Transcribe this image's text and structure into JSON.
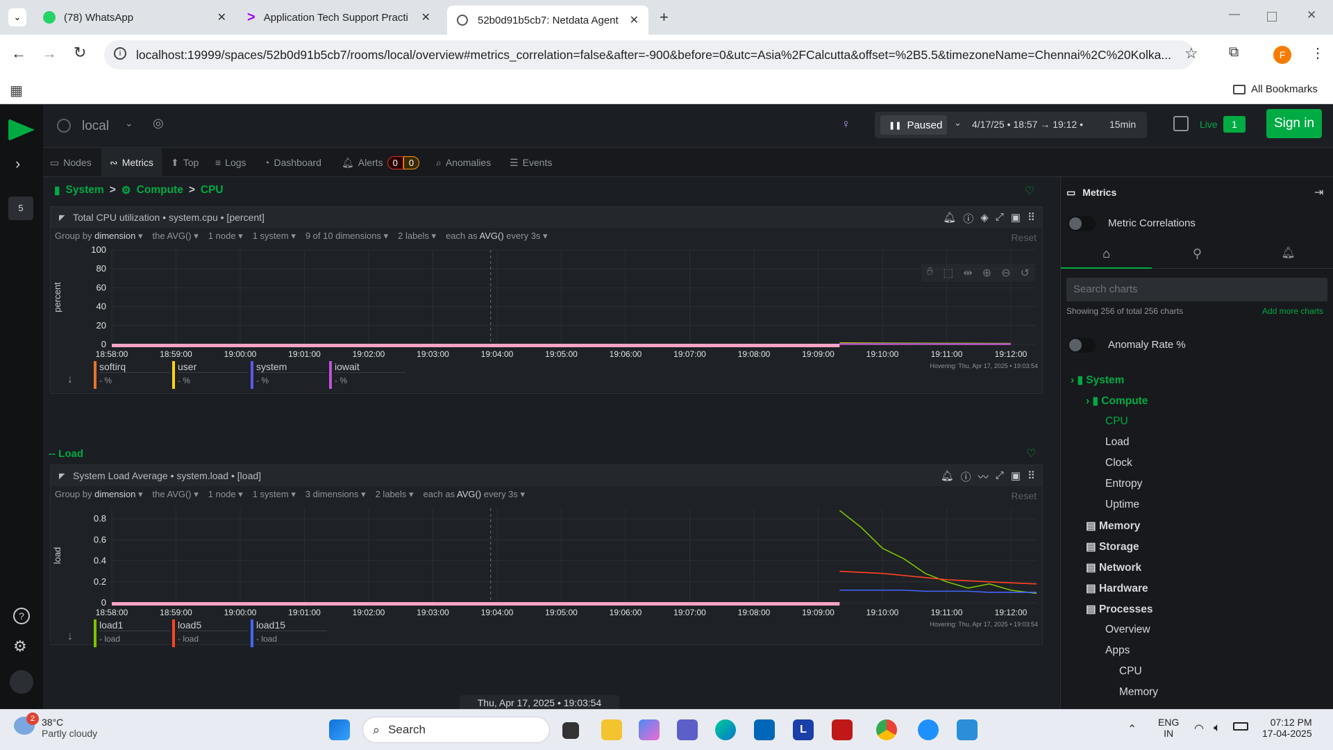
{
  "browser": {
    "tabs": [
      {
        "title": "(78) WhatsApp"
      },
      {
        "title": "Application Tech Support Practi"
      },
      {
        "title": "52b0d91b5cb7: Netdata Agent"
      }
    ],
    "url": "localhost:19999/spaces/52b0d91b5cb7/rooms/local/overview#metrics_correlation=false&after=-900&before=0&utc=Asia%2FCalcutta&offset=%2B5.5&timezoneName=Chennai%2C%20Kolka...",
    "bookmarks_label": "All Bookmarks",
    "profile_initial": "F"
  },
  "app": {
    "room": "local",
    "rail_badge": "5",
    "timecontrol": {
      "status": "Paused",
      "range": "4/17/25 • 18:57 → 19:12 •",
      "duration": "15min"
    },
    "live_label": "Live",
    "live_count": "1",
    "signin": "Sign in",
    "nav_tabs": [
      "Nodes",
      "Metrics",
      "Top",
      "Logs",
      "Dashboard",
      "Alerts",
      "Anomalies",
      "Events"
    ],
    "alerts_counts": [
      "0",
      "0"
    ],
    "breadcrumb": [
      "System",
      ">",
      "Compute",
      ">",
      "CPU"
    ],
    "section_load": "-- Load"
  },
  "cpu_chart": {
    "header": "Total CPU utilization • system.cpu • [percent]",
    "controls": [
      "Group by",
      "dimension",
      "the AVG()",
      "1 node",
      "1 system",
      "9 of 10 dimensions",
      "2 labels",
      "each as",
      "AVG()",
      "every 3s"
    ],
    "reset": "Reset",
    "hover_note": "Hovering: Thu, Apr 17, 2025 • 19:03:54",
    "legend": [
      {
        "name": "softirq",
        "unit": "%",
        "color": "#e8722a"
      },
      {
        "name": "user",
        "unit": "%",
        "color": "#ffd400"
      },
      {
        "name": "system",
        "unit": "%",
        "color": "#5a5ae8"
      },
      {
        "name": "iowait",
        "unit": "%",
        "color": "#c052d8"
      }
    ]
  },
  "load_chart": {
    "header": "System Load Average • system.load • [load]",
    "controls": [
      "Group by",
      "dimension",
      "the AVG()",
      "1 node",
      "1 system",
      "3 dimensions",
      "2 labels",
      "each as",
      "AVG()",
      "every 3s"
    ],
    "reset": "Reset",
    "hover_note": "Hovering: Thu, Apr 17, 2025 • 19:03:54",
    "legend": [
      {
        "name": "load1",
        "unit": "load",
        "color": "#7cc400"
      },
      {
        "name": "load5",
        "unit": "load",
        "color": "#ff4422"
      },
      {
        "name": "load15",
        "unit": "load",
        "color": "#4466ff"
      }
    ]
  },
  "chart_data": [
    {
      "type": "line",
      "title": "Total CPU utilization",
      "ylabel": "percent",
      "ylim": [
        0,
        100
      ],
      "yticks": [
        0,
        20,
        40,
        60,
        80,
        100
      ],
      "x": [
        "18:58:00",
        "18:59:00",
        "19:00:00",
        "19:01:00",
        "19:02:00",
        "19:03:00",
        "19:04:00",
        "19:05:00",
        "19:06:00",
        "19:07:00",
        "19:08:00",
        "19:09:00",
        "19:10:00",
        "19:11:00",
        "19:12:00"
      ],
      "series": [
        {
          "name": "user",
          "color": "#ffd400",
          "values": [
            null,
            null,
            null,
            null,
            null,
            null,
            null,
            null,
            null,
            null,
            null,
            null,
            1.5,
            1.2,
            1.0
          ]
        },
        {
          "name": "system",
          "color": "#5a5ae8",
          "values": [
            null,
            null,
            null,
            null,
            null,
            null,
            null,
            null,
            null,
            null,
            null,
            null,
            0.8,
            0.7,
            0.6
          ]
        },
        {
          "name": "softirq",
          "color": "#e8722a",
          "values": [
            null,
            null,
            null,
            null,
            null,
            null,
            null,
            null,
            null,
            null,
            null,
            null,
            0.2,
            0.1,
            0.1
          ]
        },
        {
          "name": "iowait",
          "color": "#c052d8",
          "values": [
            null,
            null,
            null,
            null,
            null,
            null,
            null,
            null,
            null,
            null,
            null,
            null,
            0.1,
            0.1,
            0.0
          ]
        }
      ],
      "grid": true
    },
    {
      "type": "line",
      "title": "System Load Average",
      "ylabel": "load",
      "ylim": [
        0,
        0.9
      ],
      "yticks": [
        0,
        0.2,
        0.4,
        0.6,
        0.8
      ],
      "x": [
        "19:09:20",
        "19:09:40",
        "19:10:00",
        "19:10:20",
        "19:10:40",
        "19:11:00",
        "19:11:20",
        "19:11:40",
        "19:12:00",
        "19:12:30"
      ],
      "series": [
        {
          "name": "load1",
          "color": "#7cc400",
          "values": [
            0.88,
            0.72,
            0.52,
            0.42,
            0.28,
            0.2,
            0.14,
            0.18,
            0.12,
            0.09
          ]
        },
        {
          "name": "load5",
          "color": "#ff4422",
          "values": [
            0.3,
            0.29,
            0.28,
            0.26,
            0.24,
            0.22,
            0.21,
            0.2,
            0.19,
            0.18
          ]
        },
        {
          "name": "load15",
          "color": "#4466ff",
          "values": [
            0.12,
            0.12,
            0.12,
            0.12,
            0.11,
            0.11,
            0.11,
            0.1,
            0.1,
            0.1
          ]
        }
      ],
      "grid": true
    }
  ],
  "xticks": [
    "18:58:00",
    "18:59:00",
    "19:00:00",
    "19:01:00",
    "19:02:00",
    "19:03:00",
    "19:04:00",
    "19:05:00",
    "19:06:00",
    "19:07:00",
    "19:08:00",
    "19:09:00",
    "19:10:00",
    "19:11:00",
    "19:12:00"
  ],
  "hover_time": "Thu, Apr 17, 2025 • 19:03:54",
  "sidebar": {
    "title": "Metrics",
    "metric_correlations": "Metric Correlations",
    "search_placeholder": "Search charts",
    "showing": "Showing 256 of total 256 charts",
    "add_more": "Add more charts",
    "anomaly_rate": "Anomaly Rate %",
    "tree": [
      {
        "label": "System",
        "level": 0,
        "green": true
      },
      {
        "label": "Compute",
        "level": 1,
        "green": true
      },
      {
        "label": "CPU",
        "level": 2,
        "green": true
      },
      {
        "label": "Load",
        "level": 2
      },
      {
        "label": "Clock",
        "level": 2
      },
      {
        "label": "Entropy",
        "level": 2
      },
      {
        "label": "Uptime",
        "level": 2
      },
      {
        "label": "Memory",
        "level": 1
      },
      {
        "label": "Storage",
        "level": 1
      },
      {
        "label": "Network",
        "level": 1
      },
      {
        "label": "Hardware",
        "level": 1
      },
      {
        "label": "Processes",
        "level": 1
      },
      {
        "label": "Overview",
        "level": 2
      },
      {
        "label": "Apps",
        "level": 2
      },
      {
        "label": "CPU",
        "level": 3
      },
      {
        "label": "Memory",
        "level": 3
      }
    ]
  },
  "taskbar": {
    "weather_temp": "38°C",
    "weather_desc": "Partly cloudy",
    "weather_badge": "2",
    "search": "Search",
    "lang": "ENG",
    "region": "IN",
    "time": "07:12 PM",
    "date": "17-04-2025"
  }
}
